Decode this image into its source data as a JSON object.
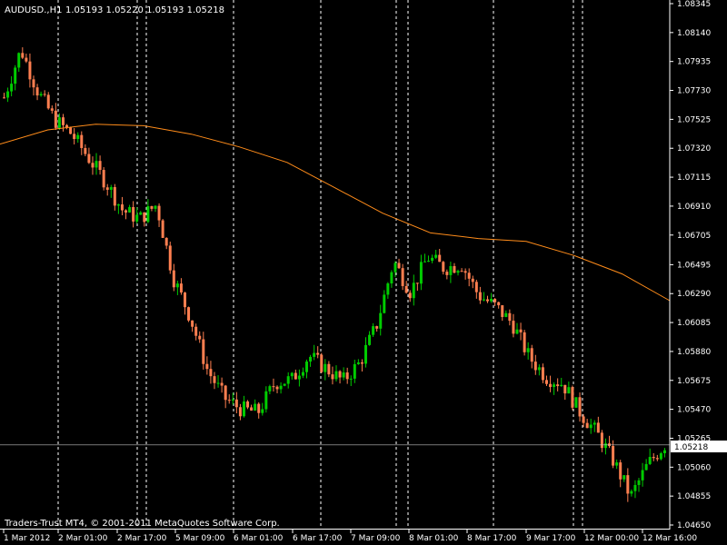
{
  "header": {
    "symbol_label": "AUDUSD.,H1",
    "ohlc_label": "1.05193 1.05220 1.05193 1.05218"
  },
  "footer": {
    "copyright": "Traders-Trust MT4, © 2001-2011 MetaQuotes Software Corp."
  },
  "colors": {
    "background": "#000000",
    "bull_candle": "#00cc00",
    "bear_candle": "#ff7f50",
    "moving_average": "#ff8c1a",
    "separators": "#ffffff",
    "axis": "#ffffff",
    "current_price_line": "#c0c0c0"
  },
  "chart_data": {
    "type": "candlestick",
    "symbol": "AUDUSD.",
    "timeframe": "H1",
    "current_price": "1.05218",
    "ylim": [
      1.0465,
      1.08345
    ],
    "y_ticks": [
      "1.08345",
      "1.08140",
      "1.07935",
      "1.07730",
      "1.07525",
      "1.07320",
      "1.07115",
      "1.06910",
      "1.06705",
      "1.06495",
      "1.06290",
      "1.06085",
      "1.05880",
      "1.05675",
      "1.05470",
      "1.05265",
      "1.05060",
      "1.04855",
      "1.04650"
    ],
    "x_ticks": [
      "1 Mar 2012",
      "2 Mar 01:00",
      "2 Mar 17:00",
      "5 Mar 09:00",
      "6 Mar 01:00",
      "6 Mar 17:00",
      "7 Mar 09:00",
      "8 Mar 01:00",
      "8 Mar 17:00",
      "9 Mar 17:00",
      "12 Mar 00:00",
      "12 Mar 16:00"
    ],
    "series": [
      {
        "type": "moving_average",
        "values": [
          1.0735,
          1.0745,
          1.0749,
          1.0748,
          1.0742,
          1.0733,
          1.0722,
          1.0704,
          1.0686,
          1.0672,
          1.0668,
          1.0666,
          1.0656,
          1.0643,
          1.0624
        ]
      },
      {
        "type": "close",
        "values": [
          1.0768,
          1.0802,
          1.0772,
          1.0752,
          1.0742,
          1.0725,
          1.0708,
          1.0688,
          1.0682,
          1.0692,
          1.064,
          1.0612,
          1.0575,
          1.0555,
          1.0547,
          1.0545,
          1.0566,
          1.0568,
          1.0585,
          1.0576,
          1.0567,
          1.058,
          1.0607,
          1.0652,
          1.063,
          1.0655,
          1.0647,
          1.065,
          1.0628,
          1.062,
          1.0608,
          1.0584,
          1.057,
          1.0565,
          1.0545,
          1.053,
          1.051,
          1.0485,
          1.0508,
          1.0522
        ]
      }
    ]
  }
}
